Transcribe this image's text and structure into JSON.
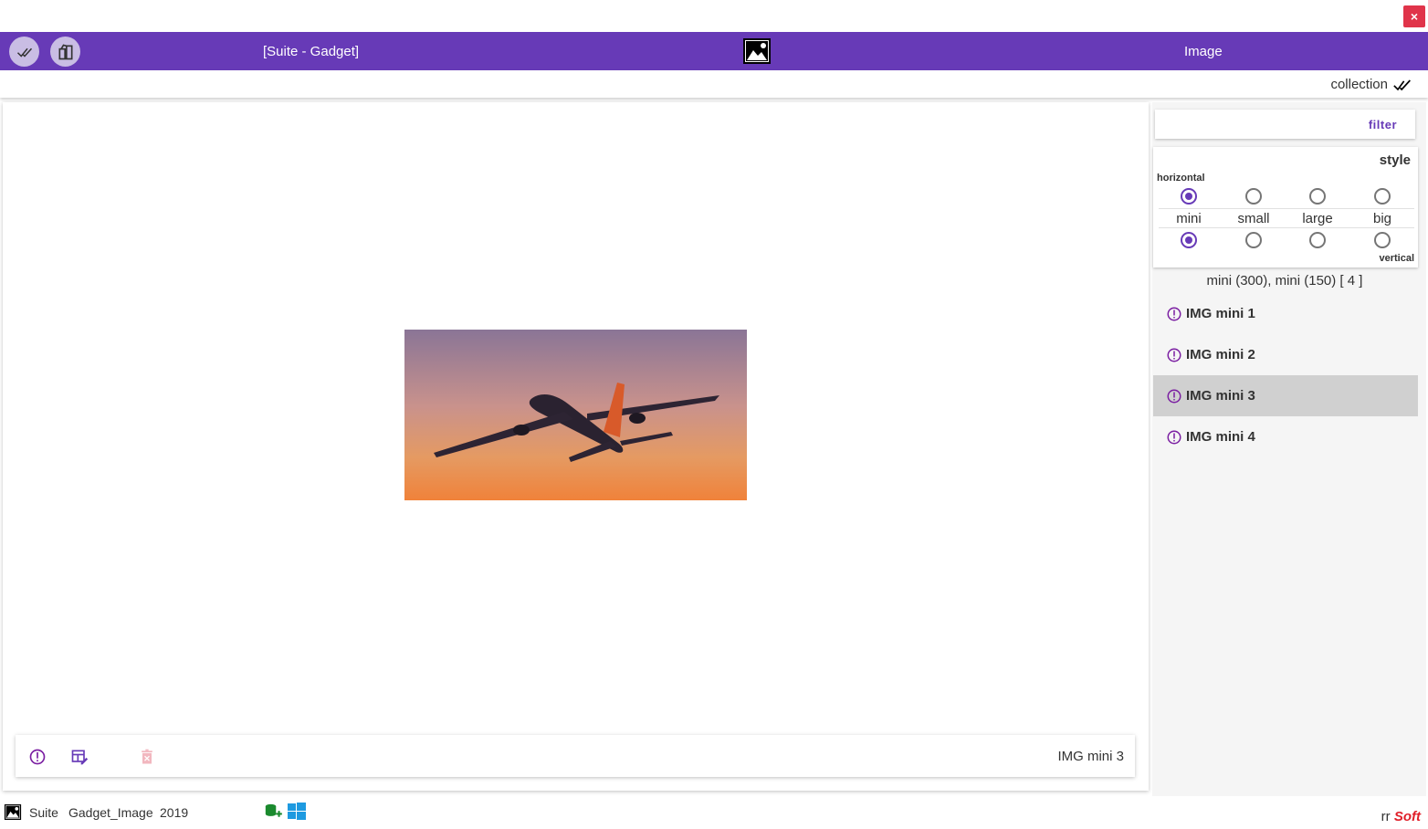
{
  "window": {
    "close_label": "×"
  },
  "appbar": {
    "title": "[Suite - Gadget]",
    "right_label": "Image",
    "icons": [
      "double-check-icon",
      "gadget-icon",
      "image-icon"
    ]
  },
  "subbar": {
    "collection_label": "collection"
  },
  "viewer": {
    "image_alt": "Airplane at sunset"
  },
  "bottom_bar": {
    "current_item": "IMG mini 3"
  },
  "side": {
    "filter_label": "filter",
    "style": {
      "title": "style",
      "horizontal_label": "horizontal",
      "vertical_label": "vertical",
      "sizes": [
        "mini",
        "small",
        "large",
        "big"
      ],
      "horizontal_selected": "mini",
      "vertical_selected": "mini"
    },
    "summary": "mini (300), mini (150)  [ 4 ]",
    "items": [
      {
        "label": "IMG mini 1",
        "selected": false
      },
      {
        "label": "IMG mini 2",
        "selected": false
      },
      {
        "label": "IMG mini 3",
        "selected": true
      },
      {
        "label": "IMG mini 4",
        "selected": false
      }
    ]
  },
  "status": {
    "suite": "Suite",
    "gadget": "Gadget_Image",
    "year": "2019",
    "brand_rr": "rr",
    "brand_soft": "Soft"
  },
  "colors": {
    "primary": "#673ab7",
    "close": "#e0344a",
    "brand": "#e0202a"
  }
}
